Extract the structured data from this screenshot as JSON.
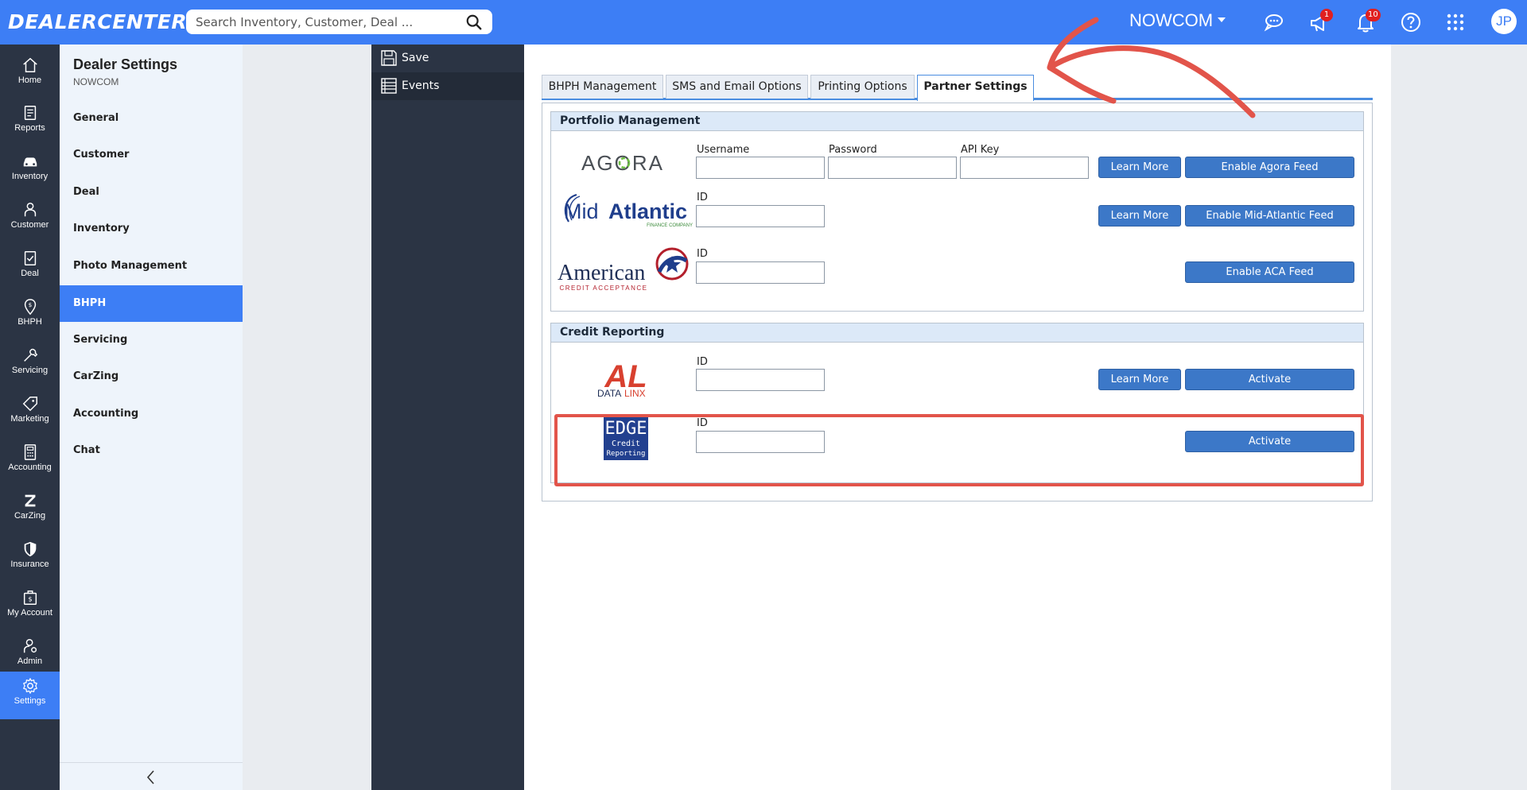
{
  "header": {
    "logo": "DEALERCENTER",
    "search_placeholder": "Search Inventory, Customer, Deal ...",
    "dealer_name": "NOWCOM",
    "announcements_badge": "1",
    "notifications_badge": "10",
    "avatar_initials": "JP",
    "accent_color": "#3d7ef5"
  },
  "left_nav": [
    {
      "label": "Home",
      "icon": "home-icon"
    },
    {
      "label": "Reports",
      "icon": "reports-icon"
    },
    {
      "label": "Inventory",
      "icon": "car-icon"
    },
    {
      "label": "Customer",
      "icon": "person-icon"
    },
    {
      "label": "Deal",
      "icon": "deal-icon"
    },
    {
      "label": "BHPH",
      "icon": "bhph-icon"
    },
    {
      "label": "Servicing",
      "icon": "wrench-icon"
    },
    {
      "label": "Marketing",
      "icon": "tag-icon"
    },
    {
      "label": "Accounting",
      "icon": "calculator-icon"
    },
    {
      "label": "CarZing",
      "icon": "carzing-icon"
    },
    {
      "label": "Insurance",
      "icon": "shield-icon"
    },
    {
      "label": "My Account",
      "icon": "account-icon"
    },
    {
      "label": "Admin",
      "icon": "admin-icon"
    },
    {
      "label": "Settings",
      "icon": "gear-icon"
    }
  ],
  "settings_panel": {
    "title": "Dealer Settings",
    "subtitle": "NOWCOM",
    "items": [
      {
        "label": "General"
      },
      {
        "label": "Customer"
      },
      {
        "label": "Deal"
      },
      {
        "label": "Inventory"
      },
      {
        "label": "Photo Management"
      },
      {
        "label": "BHPH"
      },
      {
        "label": "Servicing"
      },
      {
        "label": "CarZing"
      },
      {
        "label": "Accounting"
      },
      {
        "label": "Chat"
      }
    ]
  },
  "actions": {
    "save": "Save",
    "events": "Events"
  },
  "tabs": [
    {
      "label": "BHPH Management"
    },
    {
      "label": "SMS and Email Options"
    },
    {
      "label": "Printing Options"
    },
    {
      "label": "Partner Settings"
    }
  ],
  "portfolio": {
    "title": "Portfolio Management",
    "agora": {
      "logo_text": "AGORA",
      "username_label": "Username",
      "password_label": "Password",
      "apikey_label": "API Key",
      "learn_more": "Learn More",
      "enable": "Enable Agora Feed"
    },
    "midatlantic": {
      "logo_text_mid": "Mid",
      "logo_text_atlantic": "Atlantic",
      "logo_sub": "FINANCE COMPANY",
      "id_label": "ID",
      "learn_more": "Learn More",
      "enable": "Enable Mid-Atlantic Feed"
    },
    "aca": {
      "logo_text": "American",
      "logo_sub": "CREDIT ACCEPTANCE",
      "id_label": "ID",
      "enable": "Enable ACA Feed"
    }
  },
  "credit": {
    "title": "Credit Reporting",
    "datalinx": {
      "logo_mark": "AL",
      "logo_text_data": "DATA",
      "logo_text_linx": "LINX",
      "id_label": "ID",
      "learn_more": "Learn More",
      "activate": "Activate"
    },
    "edge": {
      "logo_line1": "EDGE",
      "logo_line2": "Credit",
      "logo_line3": "Reporting",
      "id_label": "ID",
      "activate": "Activate"
    }
  },
  "annotation_color": "#e2544a"
}
